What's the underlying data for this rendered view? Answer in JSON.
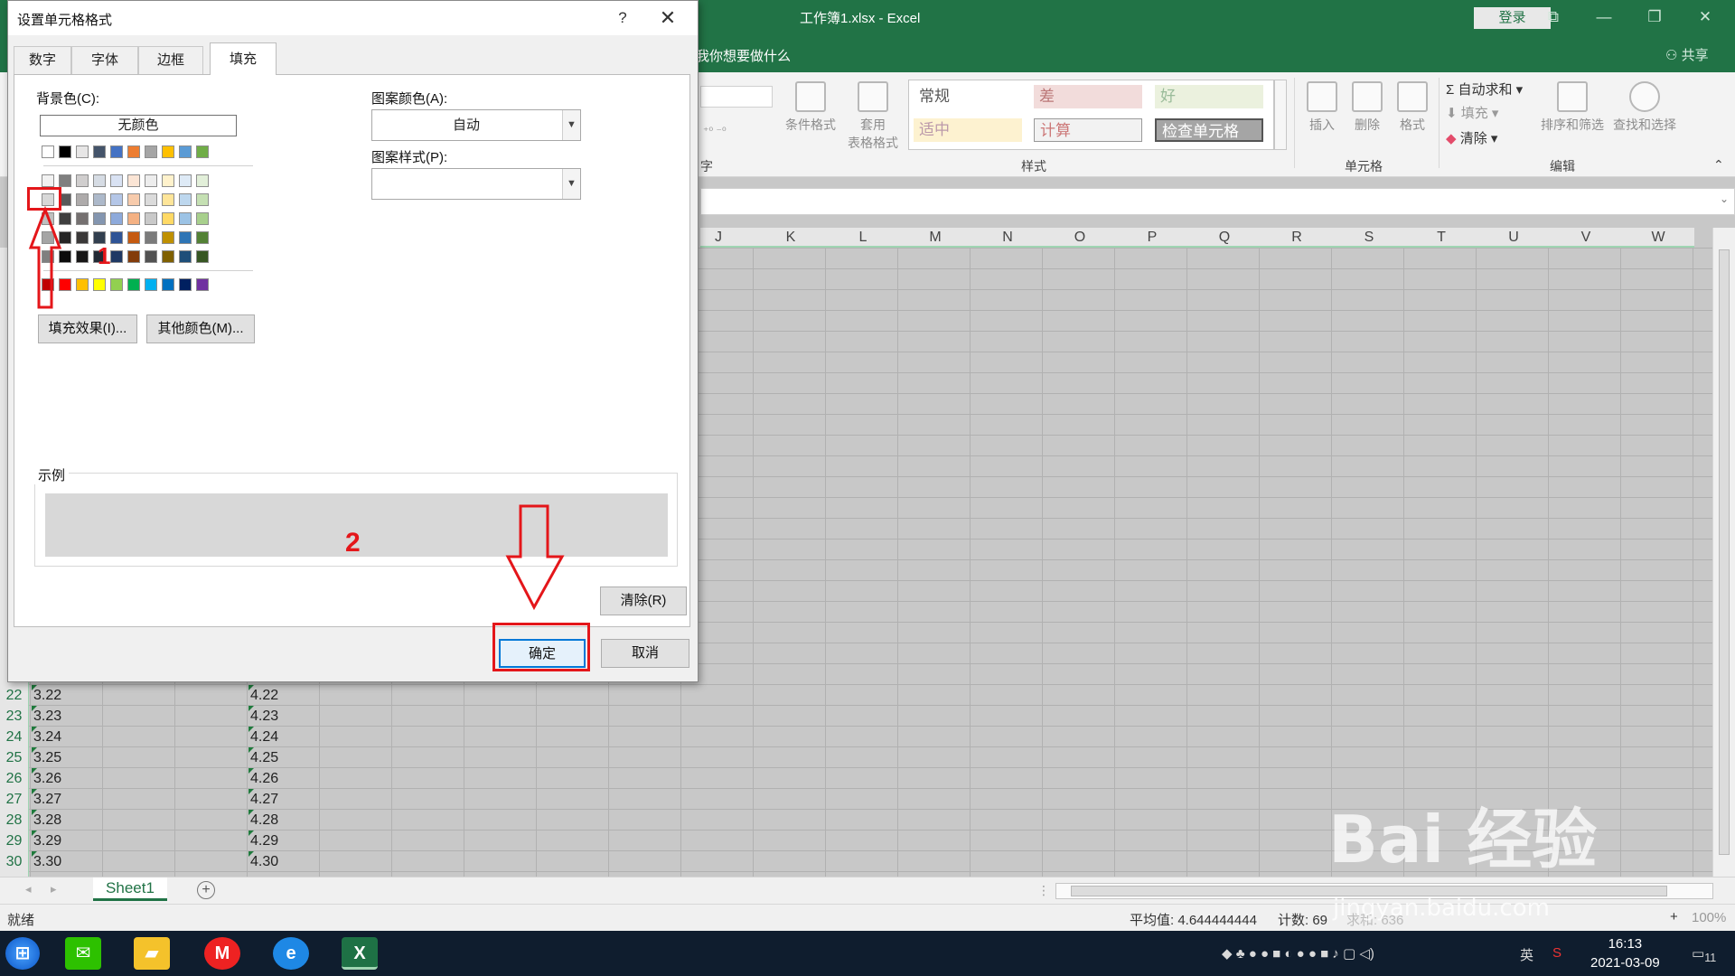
{
  "window": {
    "title": "工作簿1.xlsx  -  Excel",
    "login": "登录"
  },
  "tellme": {
    "text": "我你想要做什么",
    "share": "共享"
  },
  "ribbon": {
    "cond_format": "条件格式",
    "table_format_1": "套用",
    "table_format_2": "表格格式",
    "styles": [
      "常规",
      "差",
      "好",
      "适中",
      "计算",
      "检查单元格"
    ],
    "group_styles": "样式",
    "group_cells": "单元格",
    "group_edit": "编辑",
    "group_num_tail": "字",
    "insert": "插入",
    "delete": "删除",
    "format": "格式",
    "autosum": "自动求和",
    "fill": "填充",
    "clear": "清除",
    "sort_filter": "排序和筛选",
    "find_select": "查找和选择"
  },
  "grid": {
    "columns": [
      "J",
      "K",
      "L",
      "M",
      "N",
      "O",
      "P",
      "Q",
      "R",
      "S",
      "T",
      "U",
      "V",
      "W"
    ],
    "rows": [
      {
        "num": "22",
        "a": "3.22",
        "d": "4.22"
      },
      {
        "num": "23",
        "a": "3.23",
        "d": "4.23"
      },
      {
        "num": "24",
        "a": "3.24",
        "d": "4.24"
      },
      {
        "num": "25",
        "a": "3.25",
        "d": "4.25"
      },
      {
        "num": "26",
        "a": "3.26",
        "d": "4.26"
      },
      {
        "num": "27",
        "a": "3.27",
        "d": "4.27"
      },
      {
        "num": "28",
        "a": "3.28",
        "d": "4.28"
      },
      {
        "num": "29",
        "a": "3.29",
        "d": "4.29"
      },
      {
        "num": "30",
        "a": "3.30",
        "d": "4.30"
      }
    ]
  },
  "sheet": {
    "tab": "Sheet1",
    "add": "+"
  },
  "status": {
    "ready": "就绪",
    "average": "平均值: 4.644444444",
    "count": "计数: 69",
    "sum_partial": "求和: 636",
    "zoom": "100%",
    "zoom_plus": "+"
  },
  "taskbar": {
    "ime": "英",
    "time": "16:13",
    "date": "2021-03-09",
    "notif": "11"
  },
  "dialog": {
    "title": "设置单元格格式",
    "help": "?",
    "close": "✕",
    "tabs": [
      "数字",
      "字体",
      "边框",
      "填充"
    ],
    "bg_color_label": "背景色(C):",
    "no_color": "无颜色",
    "fill_effects": "填充效果(I)...",
    "more_colors": "其他颜色(M)...",
    "pattern_color_label": "图案颜色(A):",
    "pattern_color_value": "自动",
    "pattern_style_label": "图案样式(P):",
    "pattern_style_value": "",
    "sample_label": "示例",
    "clear": "清除(R)",
    "ok": "确定",
    "cancel": "取消",
    "palette_row1": [
      "#ffffff",
      "#000000",
      "#e7e6e6",
      "#44546a",
      "#4472c4",
      "#ed7d31",
      "#a5a5a5",
      "#ffc000",
      "#5b9bd5",
      "#70ad47"
    ],
    "palette_tints": [
      [
        "#f2f2f2",
        "#7f7f7f",
        "#d0cece",
        "#d6dce4",
        "#d9e2f3",
        "#fbe5d5",
        "#ededed",
        "#fff2cc",
        "#deeaf6",
        "#e2efd9"
      ],
      [
        "#d8d8d8",
        "#595959",
        "#aeabab",
        "#adb9ca",
        "#b4c6e7",
        "#f7cbac",
        "#dbdbdb",
        "#fee599",
        "#bdd7ee",
        "#c5e0b3"
      ],
      [
        "#bfbfbf",
        "#3f3f3f",
        "#757070",
        "#8496b0",
        "#8eaadb",
        "#f4b183",
        "#c9c9c9",
        "#ffd965",
        "#9cc3e5",
        "#a8d08d"
      ],
      [
        "#a5a5a5",
        "#262626",
        "#3a3838",
        "#323f4f",
        "#2f5496",
        "#c55a11",
        "#7b7b7b",
        "#bf9000",
        "#2e75b5",
        "#538135"
      ],
      [
        "#7f7f7f",
        "#0c0c0c",
        "#171616",
        "#222a35",
        "#1f3864",
        "#833c0b",
        "#525252",
        "#7f6000",
        "#1e4e79",
        "#375623"
      ]
    ],
    "palette_standard": [
      "#c00000",
      "#ff0000",
      "#ffc000",
      "#ffff00",
      "#92d050",
      "#00b050",
      "#00b0f0",
      "#0070c0",
      "#002060",
      "#7030a0"
    ]
  },
  "annotations": {
    "step1": "1",
    "step2": "2"
  },
  "watermark": {
    "brand": "Bai 经验",
    "url": "jingyan.baidu.com"
  }
}
